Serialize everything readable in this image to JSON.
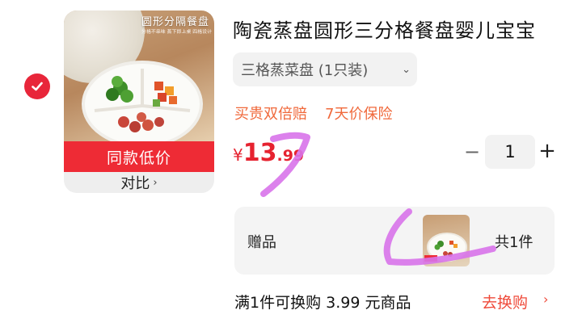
{
  "colors": {
    "accent_red": "#e62330",
    "banner_red": "#ee2b35",
    "guarantee_orange": "#f0693b",
    "scribble_purple": "#d873ea"
  },
  "item": {
    "selected": true,
    "image": {
      "overlay_title": "圆形分隔餐盘",
      "overlay_subtitle": "分格不串味 蒸下即上桌 四格设计"
    },
    "banner_label": "同款低价",
    "compare_label": "对比",
    "title": "陶瓷蒸盘圆形三分格餐盘婴儿宝宝",
    "sku_label": "三格蒸菜盘 (1只装)",
    "guarantees": [
      "买贵双倍赔",
      "7天价保险"
    ],
    "price": {
      "currency": "¥",
      "integer": "13",
      "decimal": ".99"
    },
    "quantity": "1"
  },
  "icons": {
    "check": "check-icon",
    "chevron": "chevron-right-icon",
    "dropdown": "chevron-down-icon",
    "minus": "minus-icon",
    "plus": "plus-icon"
  },
  "gift": {
    "label": "赠品",
    "count_label": "共1件"
  },
  "promo": {
    "text": "满1件可换购 3.99 元商品",
    "action_label": "去换购"
  }
}
